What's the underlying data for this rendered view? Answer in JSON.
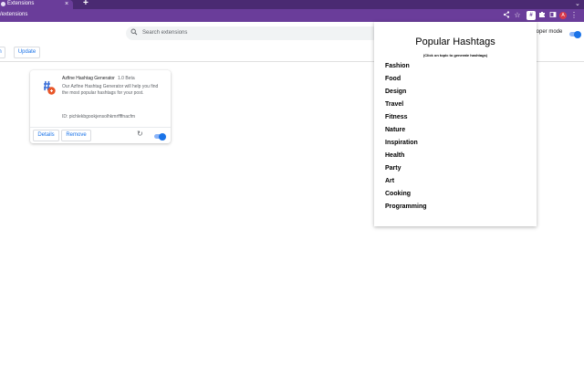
{
  "browser": {
    "tab_title": "Extensions",
    "tab_close": "×",
    "new_tab": "+",
    "url": "/extensions",
    "avatar_letter": "A",
    "toolbar_icons": [
      "share-icon",
      "star-icon",
      "hashtag-extension-icon",
      "puzzle-icon",
      "sidepanel-icon",
      "kebab-menu-icon"
    ]
  },
  "page": {
    "search_placeholder": "Search extensions",
    "dev_mode_label": "eloper mode",
    "dev_mode_on": true,
    "pack_label": "n",
    "update_label": "Update"
  },
  "extension_card": {
    "name": "Azfine Hashtag Generator",
    "version": "1.0 Beta",
    "description": "Our Azfine Hashtag Generator will help you find the most popular hashtags for your post.",
    "id": "ID: pichlekbgookjensolhkmrffffnacfm",
    "details_label": "Details",
    "remove_label": "Remove",
    "enabled": true
  },
  "popup": {
    "title": "Popular Hashtags",
    "subtitle": "(Click on topic to generate hashtags)",
    "topics": [
      "Fashion",
      "Food",
      "Design",
      "Travel",
      "Fitness",
      "Nature",
      "Inspiration",
      "Health",
      "Party",
      "Art",
      "Cooking",
      "Programming"
    ]
  },
  "colors": {
    "chrome_frame": "#4a2a72",
    "chrome_toolbar": "#6a3d9a",
    "accent": "#1a73e8",
    "avatar": "#d93a4a"
  }
}
